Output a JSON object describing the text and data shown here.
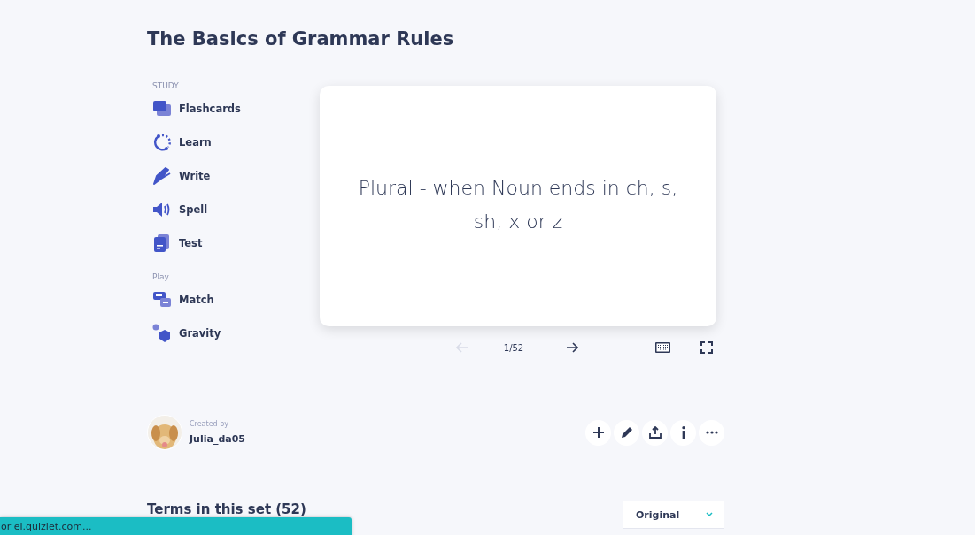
{
  "title": "The Basics of Grammar Rules",
  "sidebar": {
    "sections": [
      {
        "heading": "STUDY",
        "items": [
          {
            "label": "Flashcards",
            "kind": "cards"
          },
          {
            "label": "Learn",
            "kind": "loop"
          },
          {
            "label": "Write",
            "kind": "pen"
          },
          {
            "label": "Spell",
            "kind": "speaker"
          },
          {
            "label": "Test",
            "kind": "doc"
          }
        ]
      },
      {
        "heading": "Play",
        "items": [
          {
            "label": "Match",
            "kind": "match"
          },
          {
            "label": "Gravity",
            "kind": "gravity"
          }
        ]
      }
    ]
  },
  "card": {
    "text": "Plural - when Noun ends in ch, s, sh, x or z"
  },
  "card_controls": {
    "prev_disabled": true,
    "counter": "1/52"
  },
  "author": {
    "caption": "Created by",
    "name": "Julia_da05"
  },
  "actions": [
    {
      "kind": "add"
    },
    {
      "kind": "edit"
    },
    {
      "kind": "share"
    },
    {
      "kind": "info"
    },
    {
      "kind": "more"
    }
  ],
  "terms": {
    "heading": "Terms in this set (52)",
    "sort": "Original"
  },
  "status_bar": {
    "text": "or el.quizlet.com..."
  }
}
